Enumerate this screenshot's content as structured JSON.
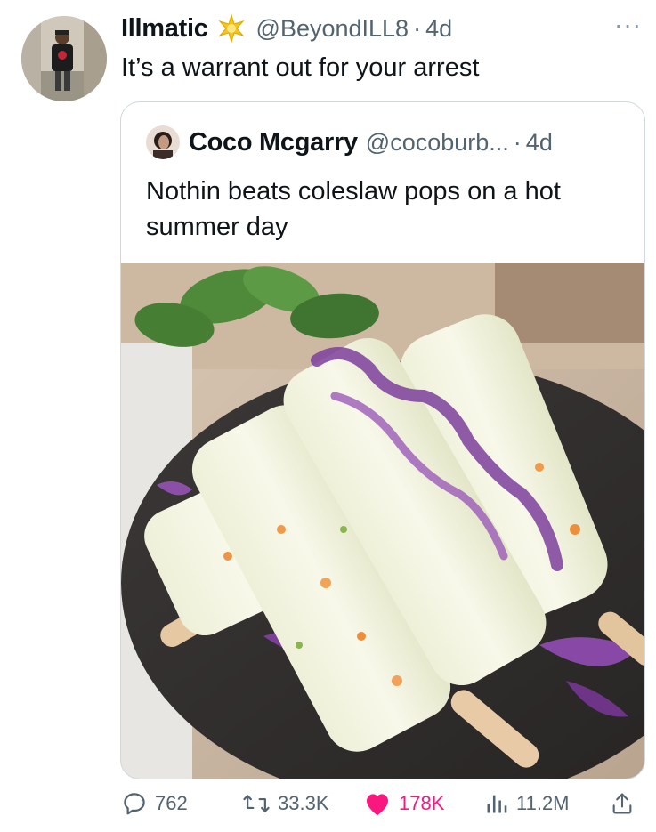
{
  "tweet": {
    "display_name": "Illmatic",
    "handle": "@BeyondILL8",
    "separator": "·",
    "time": "4d",
    "text": "It’s a warrant out for your arrest",
    "more": "···"
  },
  "quote": {
    "display_name": "Coco Mcgarry",
    "handle": "@cocoburb...",
    "separator": "·",
    "time": "4d",
    "text": "Nothin beats coleslaw pops on a hot summer day"
  },
  "actions": {
    "replies": "762",
    "retweets": "33.3K",
    "likes": "178K",
    "views": "11.2M"
  },
  "colors": {
    "text": "#0f1419",
    "secondary": "#536471",
    "like_pink": "#f91880",
    "border": "#cfd9de"
  },
  "icons": {
    "badge": "sparkle-star-icon",
    "reply": "speech-bubble-icon",
    "retweet": "retweet-arrows-icon",
    "like": "heart-icon",
    "views": "bar-chart-icon",
    "share": "share-upload-icon",
    "more": "ellipsis-icon"
  }
}
